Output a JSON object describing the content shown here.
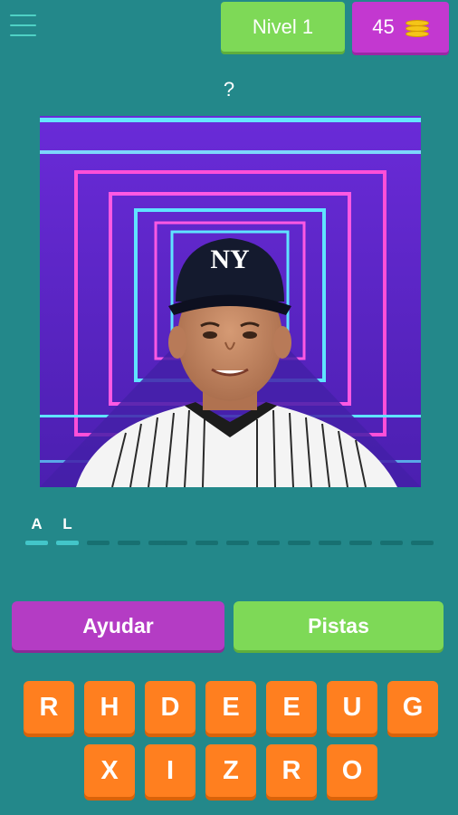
{
  "header": {
    "menu_icon": "hamburger-menu-icon",
    "level_label": "Nivel 1",
    "coins": "45",
    "coin_icon": "coin-stack-icon"
  },
  "question_mark": "?",
  "photo": {
    "description_icon": "player-photo"
  },
  "answer_slots": {
    "word1": [
      "A",
      "L",
      "",
      "",
      ""
    ],
    "word2": [
      "",
      "",
      "",
      "",
      "",
      "",
      "",
      "",
      ""
    ]
  },
  "actions": {
    "help_label": "Ayudar",
    "hints_label": "Pistas"
  },
  "keyboard": {
    "row1": [
      "R",
      "H",
      "D",
      "E",
      "E",
      "U",
      "G"
    ],
    "row2": [
      "X",
      "I",
      "Z",
      "R",
      "O"
    ]
  },
  "colors": {
    "background": "#23888a",
    "level_green": "#7ed957",
    "coins_purple": "#c338d0",
    "key_orange": "#ff7f1f"
  }
}
